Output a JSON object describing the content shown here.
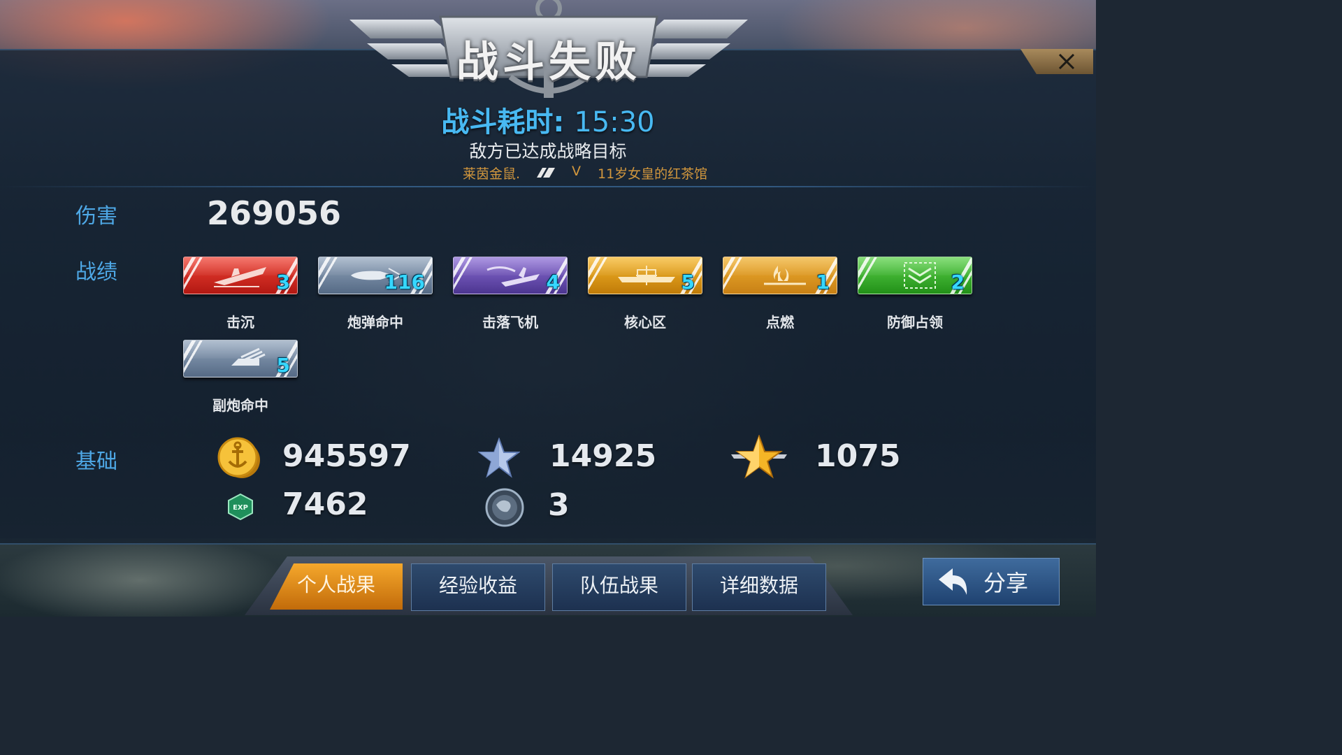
{
  "header": {
    "title": "战斗失败",
    "duration_label": "战斗耗时:",
    "duration_value": "15:30",
    "result_text": "敌方已达成战略目标",
    "player_left": "莱茵金鼠.",
    "vs": "V",
    "player_right": "11岁女皇的红茶馆"
  },
  "damage": {
    "label": "伤害",
    "value": "269056"
  },
  "record": {
    "label": "战绩",
    "medals": [
      {
        "name": "击沉",
        "count": "3",
        "color": "#e0281c",
        "icon": "ship-sink-icon"
      },
      {
        "name": "炮弹命中",
        "count": "116",
        "color": "#6f84a1",
        "icon": "shell-hit-icon"
      },
      {
        "name": "击落飞机",
        "count": "4",
        "color": "#6b4fb8",
        "icon": "plane-down-icon"
      },
      {
        "name": "核心区",
        "count": "5",
        "color": "#e19a12",
        "icon": "citadel-icon"
      },
      {
        "name": "点燃",
        "count": "1",
        "color": "#e09a22",
        "icon": "fire-icon"
      },
      {
        "name": "防御占领",
        "count": "2",
        "color": "#3bb52e",
        "icon": "defense-capture-icon"
      },
      {
        "name": "副炮命中",
        "count": "5",
        "color": "#6f84a1",
        "icon": "secondary-gun-icon"
      }
    ]
  },
  "base": {
    "label": "基础",
    "coins": "945597",
    "silver_star": "14925",
    "gold_star": "1075",
    "exp": "7462",
    "globe": "3",
    "icons": [
      "gold-anchor-coin-icon",
      "silver-star-icon",
      "gold-winged-star-icon",
      "exp-badge-icon",
      "globe-icon"
    ]
  },
  "tabs": [
    "个人战果",
    "经验收益",
    "队伍战果",
    "详细数据"
  ],
  "share": {
    "label": "分享"
  },
  "colors": {
    "accent_blue": "#48b9f2",
    "orange_name": "#d2973d",
    "count_cyan": "#36d7ff"
  }
}
